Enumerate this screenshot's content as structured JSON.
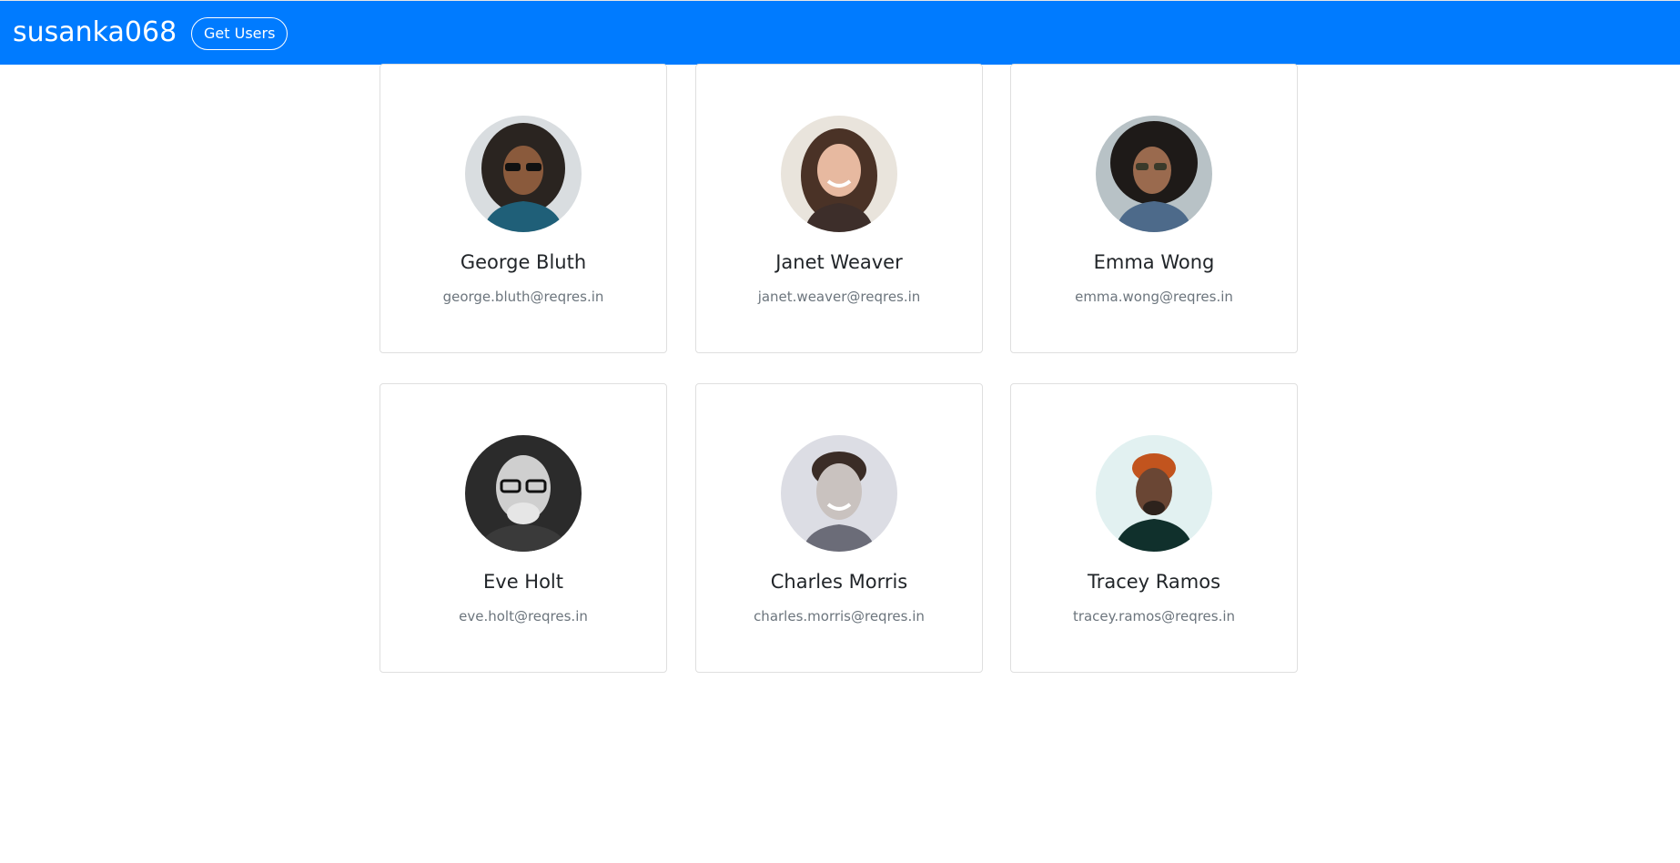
{
  "navbar": {
    "brand": "susanka068",
    "get_users_label": "Get Users",
    "background_color": "#007bff"
  },
  "users": [
    {
      "name": "George Bluth",
      "email": "george.bluth@reqres.in",
      "avatar": "photo-avatar-icon"
    },
    {
      "name": "Janet Weaver",
      "email": "janet.weaver@reqres.in",
      "avatar": "photo-avatar-icon"
    },
    {
      "name": "Emma Wong",
      "email": "emma.wong@reqres.in",
      "avatar": "photo-avatar-icon"
    },
    {
      "name": "Eve Holt",
      "email": "eve.holt@reqres.in",
      "avatar": "photo-avatar-icon"
    },
    {
      "name": "Charles Morris",
      "email": "charles.morris@reqres.in",
      "avatar": "photo-avatar-icon"
    },
    {
      "name": "Tracey Ramos",
      "email": "tracey.ramos@reqres.in",
      "avatar": "photo-avatar-icon"
    }
  ]
}
